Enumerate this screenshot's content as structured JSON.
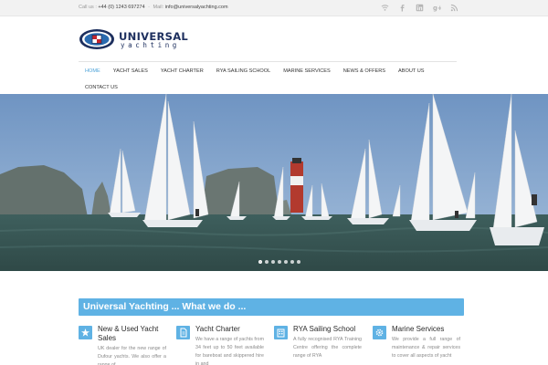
{
  "topbar": {
    "call_label": "Call us :",
    "phone": "+44 (0) 1243 697274",
    "separator": "-",
    "mail_label": "Mail:",
    "email": "info@universalyachting.com",
    "social_icons": [
      "wifi-icon",
      "facebook-icon",
      "linkedin-icon",
      "google-plus-icon",
      "rss-icon"
    ]
  },
  "logo": {
    "word1": "UNIVERSAL",
    "word2": "yachting",
    "brand_color": "#1d2f5e",
    "accent_color": "#2a6bb0"
  },
  "nav": {
    "items": [
      {
        "label": "Home",
        "active": true
      },
      {
        "label": "Yacht Sales"
      },
      {
        "label": "Yacht Charter"
      },
      {
        "label": "RYA Sailing School"
      },
      {
        "label": "Marine Services"
      },
      {
        "label": "News & Offers"
      },
      {
        "label": "About Us"
      },
      {
        "label": "Contact Us"
      }
    ],
    "active_color": "#4da3d9"
  },
  "slider": {
    "slide_count": 7,
    "active_index": 0
  },
  "section": {
    "title": "Universal Yachting ... What we do ...",
    "accent": "#5fb2e4"
  },
  "features": [
    {
      "icon": "star-icon",
      "title": "New & Used Yacht Sales",
      "text": "UK dealer for the new range of Dufour yachts. We also offer a range of"
    },
    {
      "icon": "document-icon",
      "title": "Yacht Charter",
      "text": "We have a range of yachts from 34 feet up to 50 feet available for bareboat and skippered hire in and"
    },
    {
      "icon": "building-icon",
      "title": "RYA Sailing School",
      "text": "A fully recognised RYA Training Centre offering the complete range of RYA"
    },
    {
      "icon": "gear-icon",
      "title": "Marine Services",
      "text": "We provide a full range of maintenance & repair services to cover all aspects of yacht"
    }
  ]
}
